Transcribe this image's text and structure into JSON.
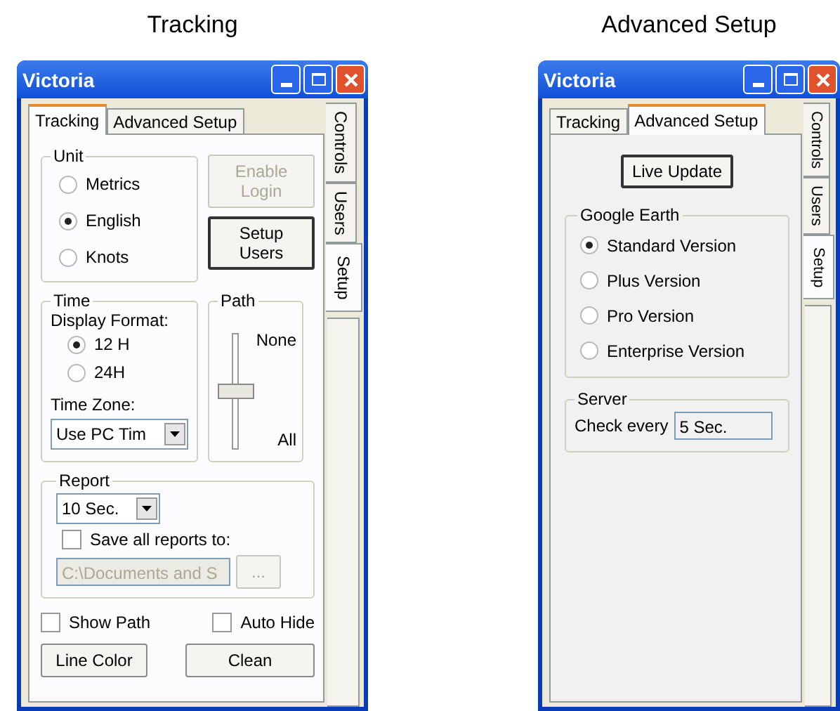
{
  "panels": [
    {
      "caption": "Tracking",
      "kind": "tracking",
      "window": {
        "title": "Victoria",
        "tabs": [
          {
            "label": "Tracking",
            "selected": true
          },
          {
            "label": "Advanced Setup",
            "selected": false
          }
        ],
        "side_tabs": [
          {
            "label": "Controls",
            "selected": false
          },
          {
            "label": "Users",
            "selected": false
          },
          {
            "label": "Setup",
            "selected": true
          }
        ],
        "unit": {
          "legend": "Unit",
          "options": [
            {
              "label": "Metrics",
              "selected": false
            },
            {
              "label": "English",
              "selected": true
            },
            {
              "label": "Knots",
              "selected": false
            }
          ]
        },
        "enable_login": {
          "label": "Enable Login",
          "disabled": true
        },
        "setup_users": {
          "label": "Setup Users",
          "disabled": false
        },
        "time": {
          "legend": "Time",
          "format_label": "Display Format:",
          "options": [
            {
              "label": "12 H",
              "selected": true
            },
            {
              "label": "24H",
              "selected": false
            }
          ],
          "zone_label": "Time Zone:",
          "zone_value": "Use PC Tim"
        },
        "path": {
          "legend": "Path",
          "top_label": "None",
          "bottom_label": "All",
          "level": 0.5
        },
        "report": {
          "legend": "Report",
          "interval": "10 Sec.",
          "save": {
            "label": "Save all reports to:",
            "checked": false
          },
          "folder": "C:\\Documents and S",
          "browse": "..."
        },
        "show_path": {
          "label": "Show Path",
          "checked": false
        },
        "auto_hide": {
          "label": "Auto Hide",
          "checked": false
        },
        "buttons": [
          "Line Color",
          "Clean"
        ]
      }
    },
    {
      "caption": "Advanced Setup",
      "kind": "advanced",
      "window": {
        "title": "Victoria",
        "tabs": [
          {
            "label": "Tracking",
            "selected": false
          },
          {
            "label": "Advanced Setup",
            "selected": true
          }
        ],
        "side_tabs": [
          {
            "label": "Controls",
            "selected": false
          },
          {
            "label": "Users",
            "selected": false
          },
          {
            "label": "Setup",
            "selected": true
          }
        ],
        "live_update": "Live Update",
        "google_earth": {
          "legend": "Google Earth",
          "options": [
            {
              "label": "Standard Version",
              "selected": true
            },
            {
              "label": "Plus Version",
              "selected": false
            },
            {
              "label": "Pro Version",
              "selected": false
            },
            {
              "label": "Enterprise Version",
              "selected": false
            }
          ]
        },
        "server": {
          "legend": "Server",
          "label": "Check every",
          "value": "5 Sec."
        }
      }
    }
  ]
}
